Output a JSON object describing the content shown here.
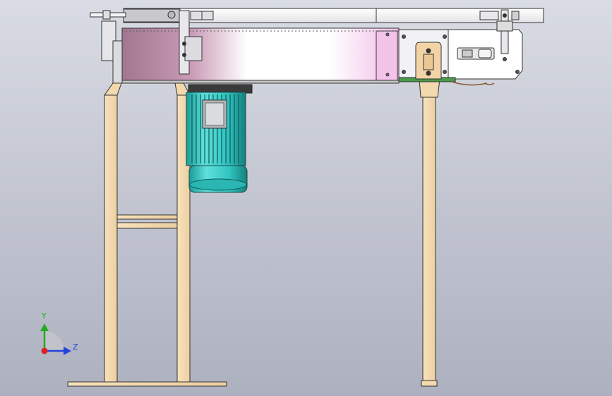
{
  "viewport": {
    "background_top": "#d9dce4",
    "background_bottom": "#adb1bf"
  },
  "model": {
    "frame_color": "#f5dcb4",
    "frame_edge": "#3a3a3a",
    "cover_gradient": [
      "#a77c93",
      "#e8c4dc",
      "#ffffff",
      "#f0c2e8"
    ],
    "motor_color": "#2ec4c0",
    "motor_dark": "#1a8a88"
  },
  "triad": {
    "y_label": "Y",
    "z_label": "Z",
    "y_color": "#22aa22",
    "z_color": "#2244dd",
    "origin_color": "#dd2222"
  }
}
